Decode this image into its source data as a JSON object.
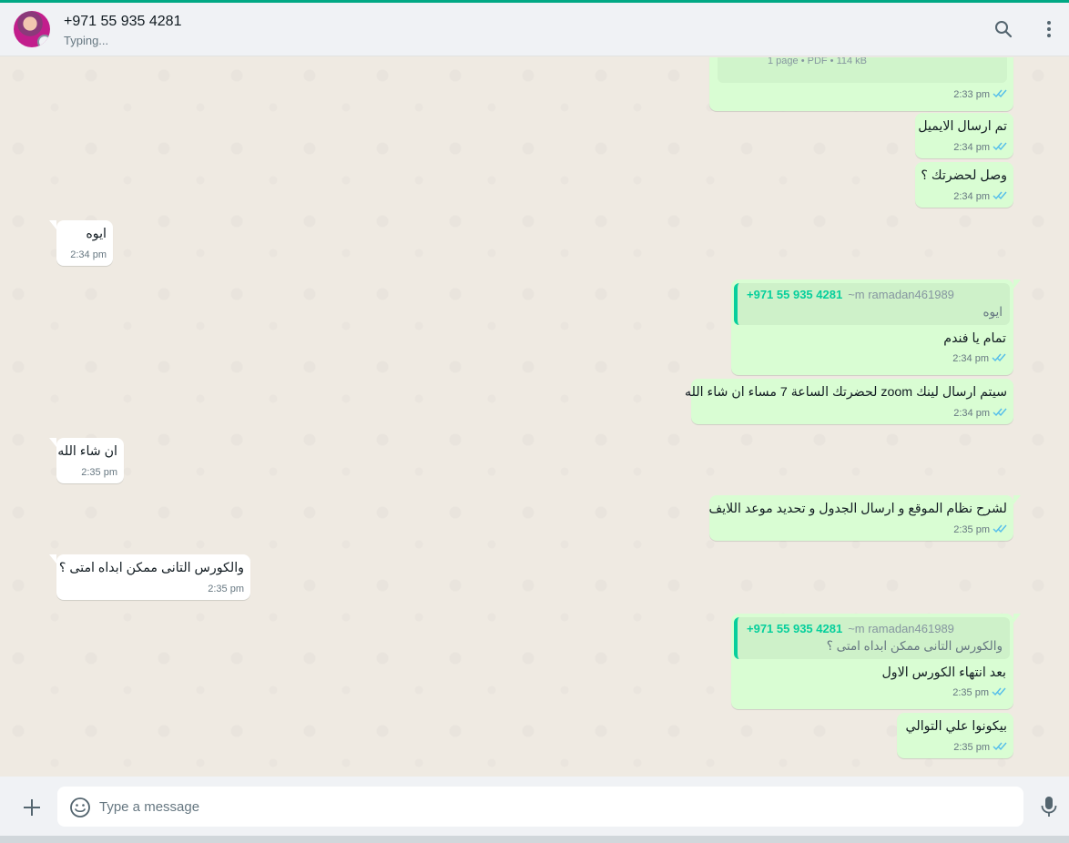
{
  "header": {
    "contact_name": "+971 55 935 4281",
    "contact_status": "Typing...",
    "icons": [
      "search-icon",
      "menu-icon"
    ]
  },
  "colors": {
    "accent": "#00a884",
    "outgoing_bubble": "#d9fdd3",
    "incoming_bubble": "#ffffff",
    "read_ticks": "#53bdeb"
  },
  "messages": [
    {
      "direction": "out",
      "doc_meta": "1 page • PDF • 114 kB",
      "time": "2:33 pm",
      "status": "read"
    },
    {
      "direction": "out",
      "text": "تم ارسال الايميل",
      "time": "2:34 pm",
      "status": "read"
    },
    {
      "direction": "out",
      "text": "وصل لحضرتك ؟",
      "time": "2:34 pm",
      "status": "read"
    },
    {
      "direction": "in",
      "text": "ايوه",
      "time": "2:34 pm"
    },
    {
      "direction": "out",
      "quote": {
        "author": "+971 55 935 4281",
        "pushname": "~m ramadan461989",
        "text": "ايوه"
      },
      "text": "تمام يا فندم",
      "time": "2:34 pm",
      "status": "read"
    },
    {
      "direction": "out",
      "text": "سيتم ارسال لينك zoom لحضرتك الساعة 7 مساء ان شاء الله",
      "time": "2:34 pm",
      "status": "read"
    },
    {
      "direction": "in",
      "text": "ان شاء الله",
      "time": "2:35 pm"
    },
    {
      "direction": "out",
      "text": "لشرح نظام الموقع و ارسال الجدول و تحديد موعد اللايف",
      "time": "2:35 pm",
      "status": "read"
    },
    {
      "direction": "in",
      "text": "والكورس التانى ممكن ابداه امتى ؟",
      "time": "2:35 pm"
    },
    {
      "direction": "out",
      "quote": {
        "author": "+971 55 935 4281",
        "pushname": "~m ramadan461989",
        "text": "والكورس التانى ممكن ابداه امتى ؟"
      },
      "text": "بعد انتهاء الكورس الاول",
      "time": "2:35 pm",
      "status": "read"
    },
    {
      "direction": "out",
      "text": "بيكونوا علي التوالي",
      "time": "2:35 pm",
      "status": "read"
    }
  ],
  "composer": {
    "placeholder": "Type a message",
    "icons": [
      "plus-icon",
      "emoji-icon",
      "microphone-icon"
    ]
  }
}
